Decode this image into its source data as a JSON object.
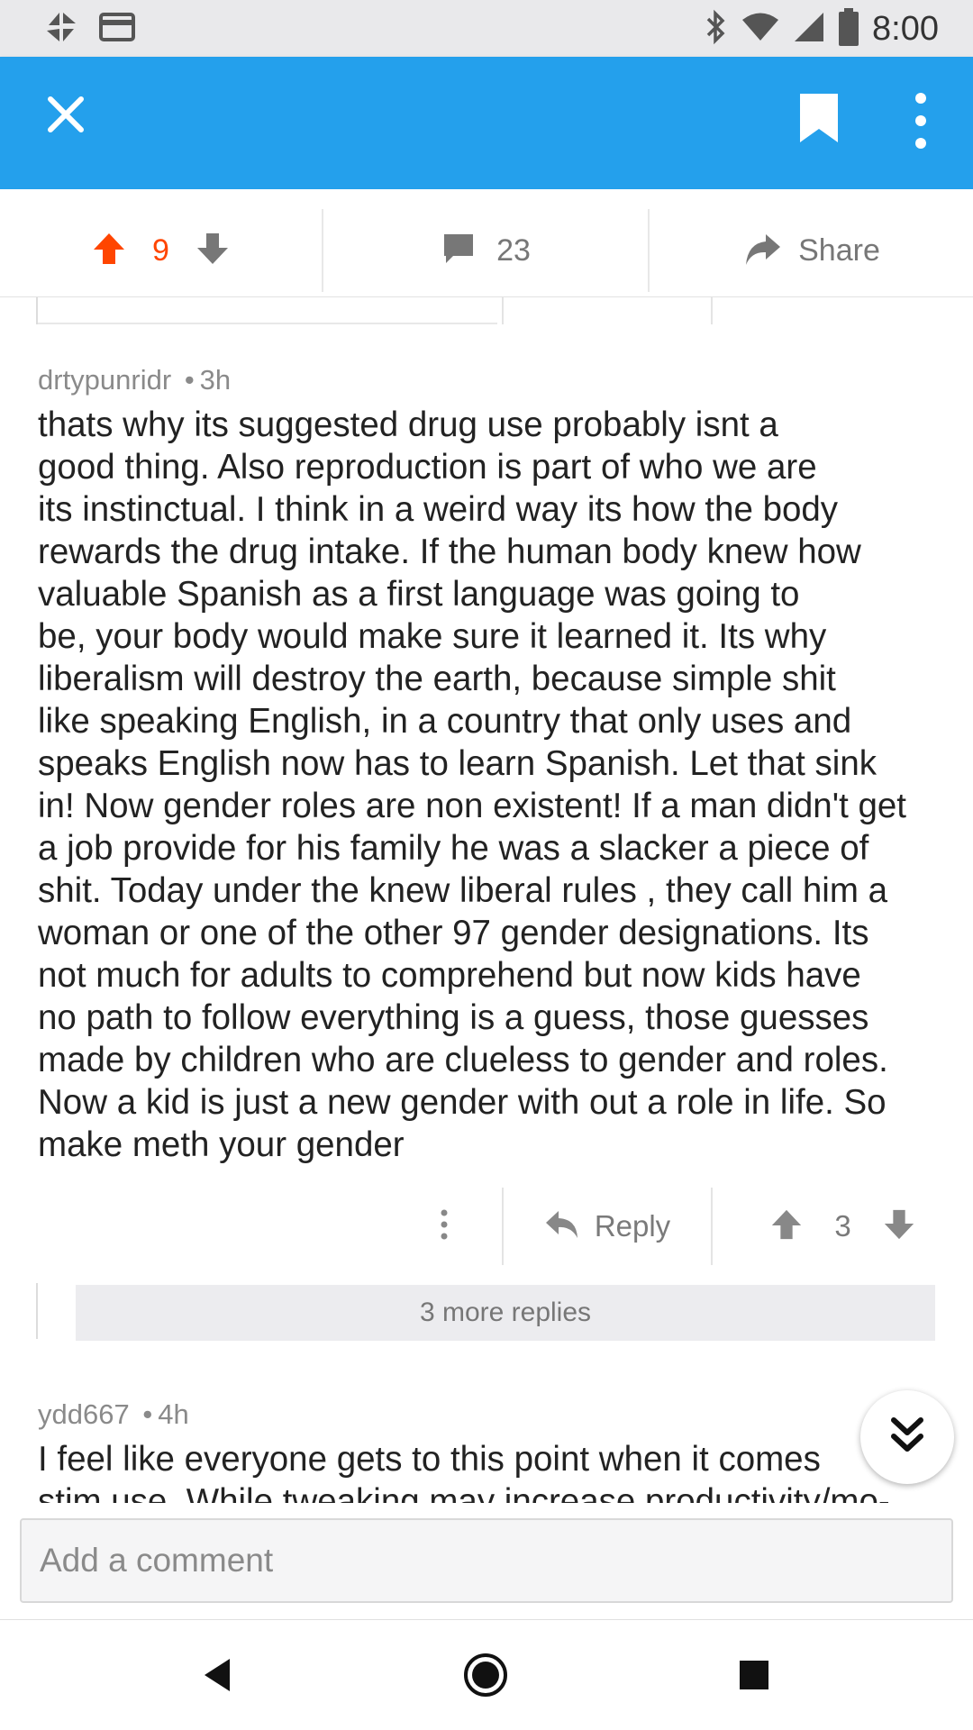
{
  "status_bar": {
    "time": "8:00",
    "icons": [
      "pinwheel-icon",
      "card-icon",
      "bluetooth-icon",
      "wifi-icon",
      "signal-icon",
      "battery-icon"
    ]
  },
  "app_bar": {
    "color": "#24a0ec",
    "icons": [
      "close-icon",
      "bookmark-icon",
      "more-vert-icon"
    ]
  },
  "post_actions": {
    "vote_count": "9",
    "comment_count": "23",
    "share_label": "Share",
    "upvote_color": "#ff4500"
  },
  "comment": {
    "author": "drtypunridr",
    "separator": "•",
    "age": "3h",
    "body": "thats why its suggested drug use probably isnt a\ngood thing. Also reproduction is part of who we are\nits instinctual. I think in a weird way its how the body\nrewards the drug intake. If the human body knew how\nvaluable Spanish as a first language was going to\nbe, your body would make sure it learned it. Its why\nliberalism will destroy the earth, because simple shit\nlike speaking English, in a country that only uses and\nspeaks English now has to learn Spanish. Let that sink\nin! Now gender roles are non existent! If a man didn't get\na job provide for his family he was a slacker a piece of\nshit. Today under the knew liberal rules , they call him a\nwoman or one of the other 97 gender designations. Its\nnot much for adults to comprehend but now kids have\nno path to follow everything is a guess, those guesses\nmade by children who are clueless to gender and roles.\nNow a kid is just a new gender with out a role in life. So\nmake meth your gender",
    "reply_label": "Reply",
    "score": "3",
    "more_replies_label": "3 more replies"
  },
  "comment2": {
    "author": "ydd667",
    "separator": "•",
    "age": "4h",
    "body": "I feel like everyone gets to this point when it comes\nstim use. While tweaking may increase productivity/mo-"
  },
  "composer": {
    "placeholder": "Add a comment"
  },
  "nav_bar": {
    "icons": [
      "back-icon",
      "home-icon",
      "recents-icon"
    ]
  }
}
